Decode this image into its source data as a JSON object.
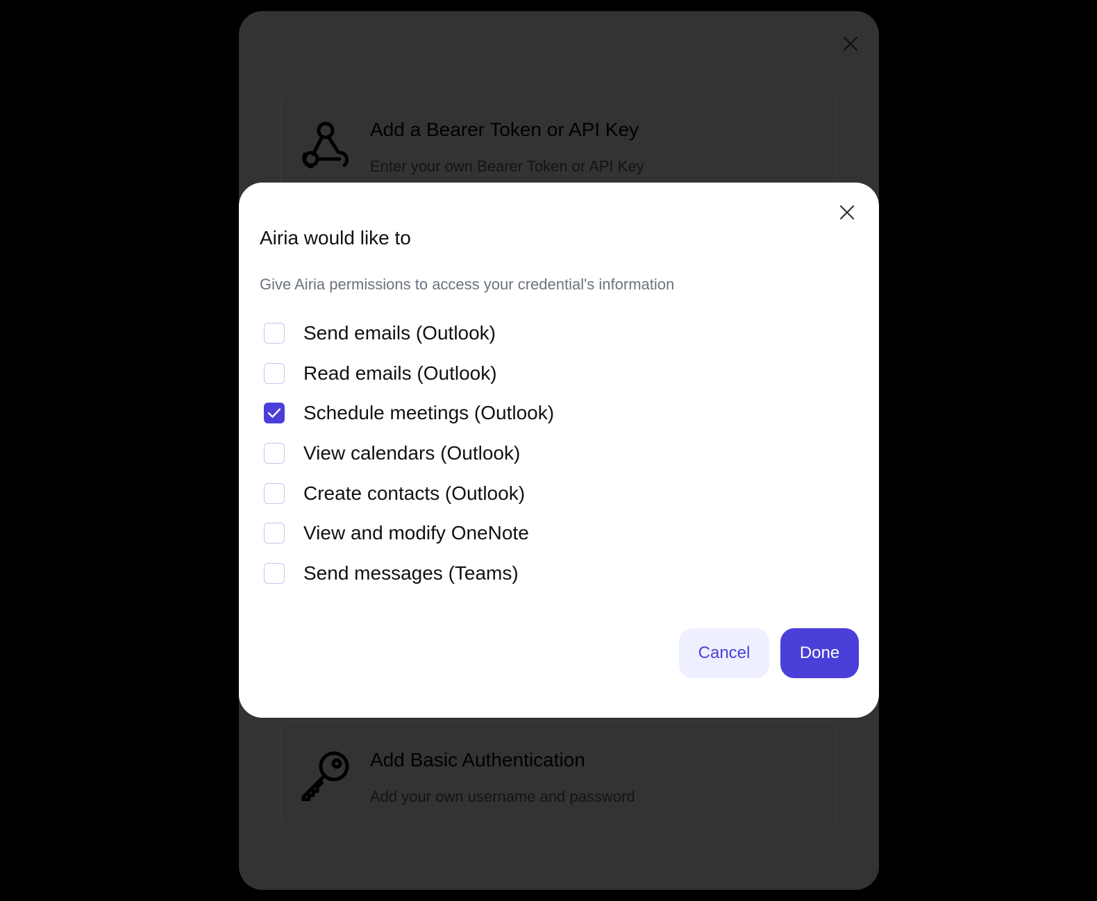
{
  "background_page": {
    "fragments": [
      "",
      "",
      "",
      "",
      ""
    ]
  },
  "back_modal": {
    "options": [
      {
        "icon": "webhook-icon",
        "title": "Add a Bearer Token or API Key",
        "description": "Enter your own Bearer Token or API Key"
      },
      {
        "icon": "key-icon",
        "title": "Add Basic Authentication",
        "description": "Add your own username and password"
      }
    ]
  },
  "dialog": {
    "title": "Airia would like to",
    "subtitle": "Give Airia permissions to access your credential's information",
    "permissions": [
      {
        "label": "Send emails (Outlook)",
        "checked": false
      },
      {
        "label": "Read emails (Outlook)",
        "checked": false
      },
      {
        "label": "Schedule meetings (Outlook)",
        "checked": true
      },
      {
        "label": "View calendars (Outlook)",
        "checked": false
      },
      {
        "label": "Create contacts (Outlook)",
        "checked": false
      },
      {
        "label": "View and modify OneNote",
        "checked": false
      },
      {
        "label": "Send messages (Teams)",
        "checked": false
      }
    ],
    "cancel_label": "Cancel",
    "done_label": "Done"
  },
  "colors": {
    "accent": "#4a3fd9",
    "accent_soft": "#eef0ff",
    "overlay": "#000000",
    "dimmed_modal": "#333333"
  }
}
